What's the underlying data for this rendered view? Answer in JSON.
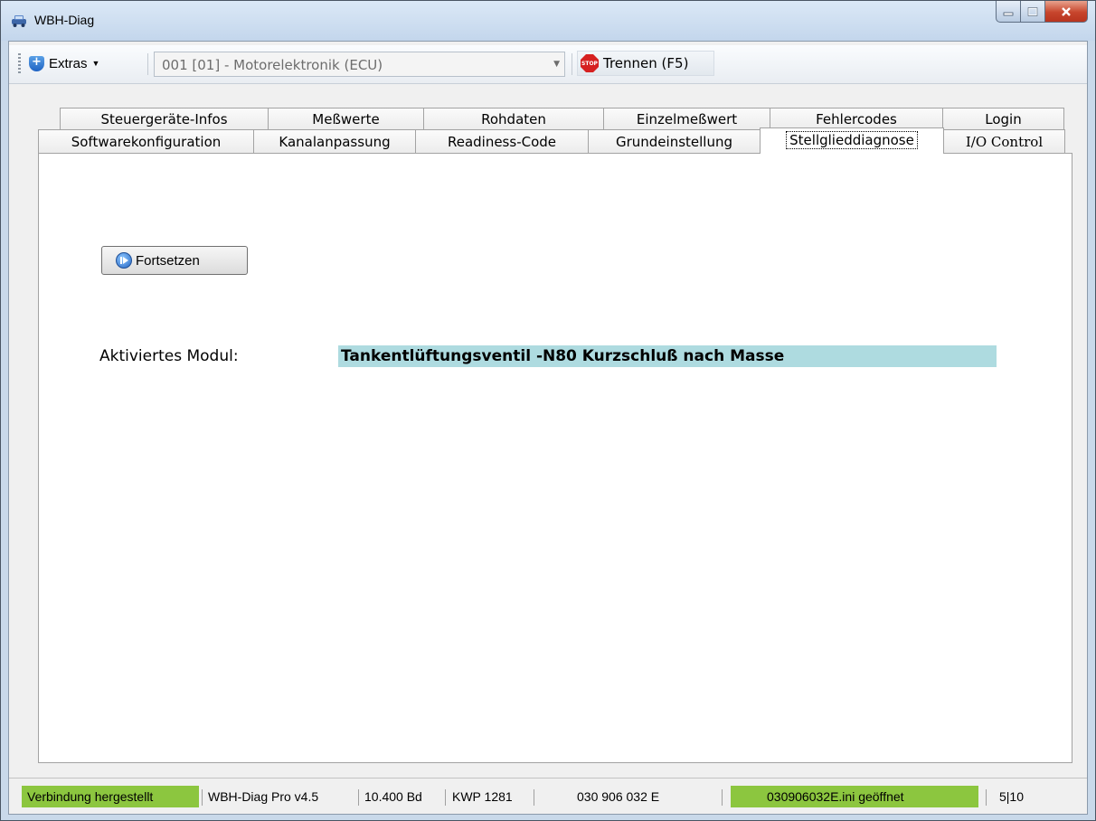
{
  "window": {
    "title": "WBH-Diag"
  },
  "toolbar": {
    "extras_label": "Extras",
    "module_select": "001 [01] - Motorelektronik (ECU)",
    "disconnect_label": "Trennen (F5)",
    "stop_icon_text": "STOP"
  },
  "tabs": {
    "row1": [
      "Steuergeräte-Infos",
      "Meßwerte",
      "Rohdaten",
      "Einzelmeßwert",
      "Fehlercodes",
      "Login"
    ],
    "row2": [
      "Softwarekonfiguration",
      "Kanalanpassung",
      "Readiness-Code",
      "Grundeinstellung",
      "Stellglieddiagnose",
      "I/O Control"
    ],
    "active": "Stellglieddiagnose"
  },
  "panel": {
    "continue_button": "Fortsetzen",
    "active_module_label": "Aktiviertes Modul:",
    "active_module_value": "Tankentlüftungsventil -N80 Kurzschluß nach Masse"
  },
  "statusbar": {
    "connection": "Verbindung hergestellt",
    "version": "WBH-Diag Pro v4.5",
    "baud": "10.400 Bd",
    "protocol": "KWP 1281",
    "part_number": "030 906 032 E",
    "ini_file": "030906032E.ini geöffnet",
    "counter": "5|10"
  },
  "colors": {
    "status_green": "#8cc63f",
    "module_highlight": "#aedbe0",
    "close_button": "#c7452c"
  }
}
